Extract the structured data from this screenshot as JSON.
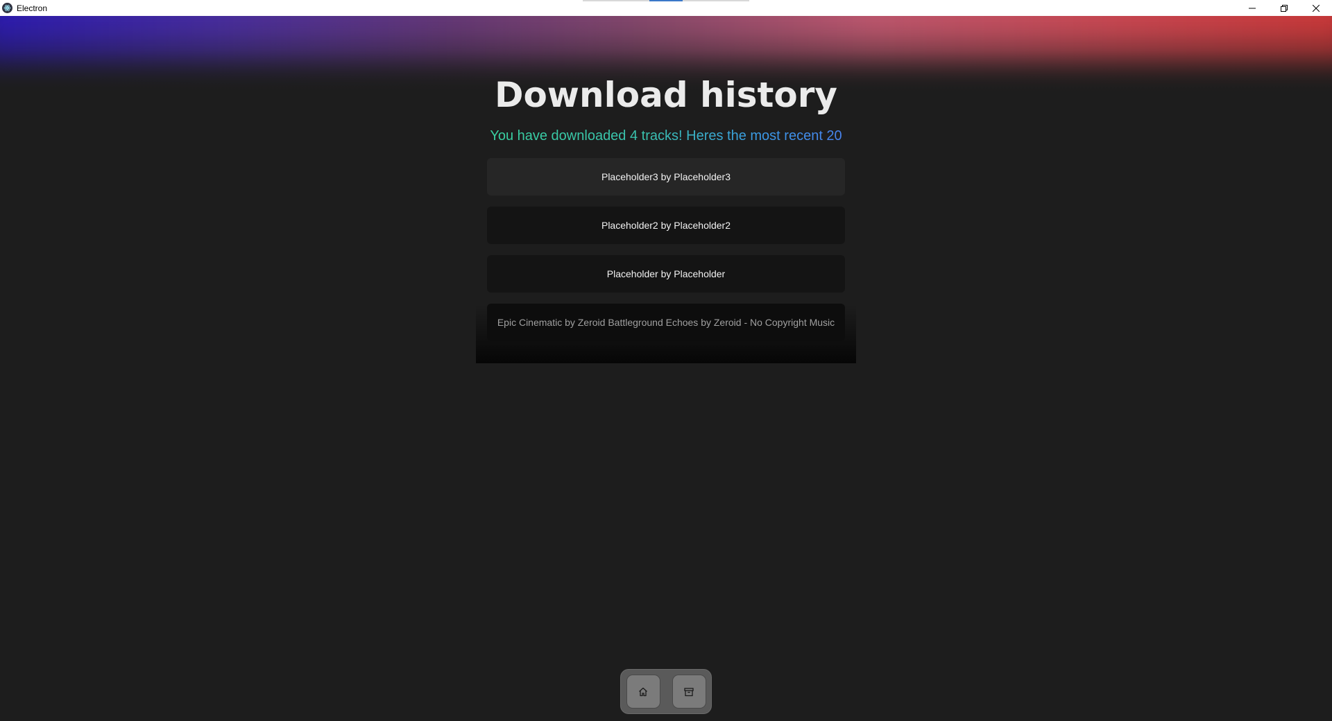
{
  "window": {
    "title": "Electron",
    "icons": {
      "app": "electron-icon",
      "minimize": "minimize-icon",
      "restore": "restore-icon",
      "close": "close-icon"
    }
  },
  "page": {
    "heading": "Download history",
    "subtitle": "You have downloaded 4 tracks! Heres the most recent 20"
  },
  "tracks": [
    {
      "label": "Placeholder3 by Placeholder3"
    },
    {
      "label": "Placeholder2 by Placeholder2"
    },
    {
      "label": "Placeholder by Placeholder"
    },
    {
      "label": "Epic Cinematic by Zeroid Battleground Echoes by Zeroid - No Copyright Music"
    }
  ],
  "dock": {
    "buttons": [
      {
        "icon": "home-icon"
      },
      {
        "icon": "archive-icon"
      }
    ]
  },
  "colors": {
    "background": "#1d1d1d",
    "glow_left": "#2a19b8",
    "glow_right": "#d23838",
    "subtitle_start": "#39d3a0",
    "subtitle_end": "#4a7ff0"
  }
}
